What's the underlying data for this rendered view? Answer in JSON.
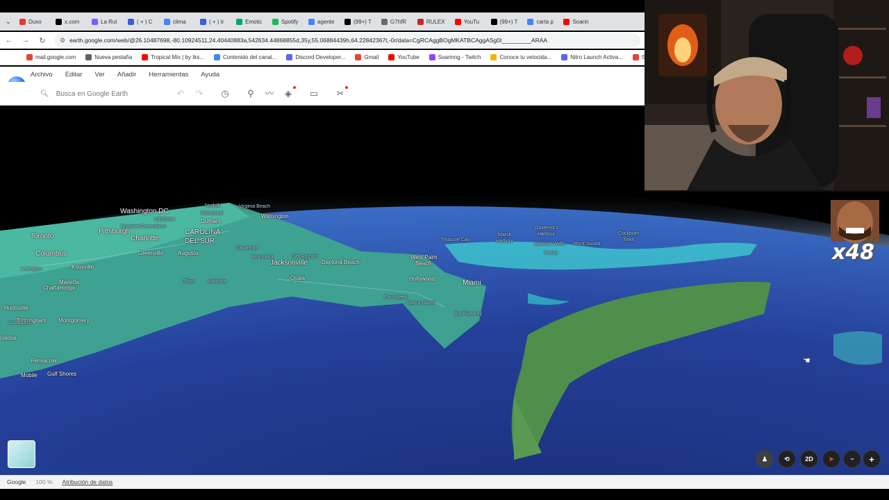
{
  "browser": {
    "tabs": [
      {
        "label": "Duxo",
        "color": "#e53935"
      },
      {
        "label": "x.com",
        "color": "#000000"
      },
      {
        "label": "La Rul",
        "color": "#7b5cff"
      },
      {
        "label": "( + ) C",
        "color": "#3b5bdb"
      },
      {
        "label": "clima",
        "color": "#4285f4"
      },
      {
        "label": "( + ) Ir",
        "color": "#3b5bdb"
      },
      {
        "label": "Emotic",
        "color": "#00a86b"
      },
      {
        "label": "Spotify",
        "color": "#1db954"
      },
      {
        "label": "agente",
        "color": "#4285f4"
      },
      {
        "label": "(99+) T",
        "color": "#000000"
      },
      {
        "label": "G7hfR",
        "color": "#6b6b6b"
      },
      {
        "label": "RULEX",
        "color": "#c62828"
      },
      {
        "label": "YouTu",
        "color": "#ff0000"
      },
      {
        "label": "(99+) T",
        "color": "#000000"
      },
      {
        "label": "carta p",
        "color": "#4285f4"
      },
      {
        "label": "Soarin",
        "color": "#ff0000"
      }
    ],
    "url": "earth.google.com/web/@26.10487698,-80.10924511,24.40440883a,542634.44868855d,35y,55.06884439h,64.22842367t,-0r/data=CgRCAggBOgMKATBCAggASg0I_________ARAA",
    "bookmarks": [
      {
        "label": "mail.google.com",
        "color": "#ea4335"
      },
      {
        "label": "Nueva pestaña",
        "color": "#5f6368"
      },
      {
        "label": "Tropical Mix | by Iks...",
        "color": "#ff0000"
      },
      {
        "label": "Contenido del canal...",
        "color": "#4285f4"
      },
      {
        "label": "Discord Developer...",
        "color": "#5865f2"
      },
      {
        "label": "Gmail",
        "color": "#ea4335"
      },
      {
        "label": "YouTube",
        "color": "#ff0000"
      },
      {
        "label": "Soarinng - Twitch",
        "color": "#9146ff"
      },
      {
        "label": "Conoce tu velocida...",
        "color": "#f4b400"
      },
      {
        "label": "Nitro Launch Activa...",
        "color": "#5865f2"
      },
      {
        "label": "Si",
        "color": "#ea4335"
      }
    ]
  },
  "earth": {
    "menu": [
      "Archivo",
      "Editar",
      "Ver",
      "Añadir",
      "Herramientas",
      "Ayuda"
    ],
    "search_placeholder": "Busca en Google Earth",
    "toolbar_icons": [
      "undo-icon",
      "redo-icon",
      "history-icon",
      "placemark-icon",
      "path-icon",
      "layers-icon",
      "measure-icon",
      "tools-icon"
    ]
  },
  "map_labels": [
    {
      "text": "Washington DC",
      "size": "big"
    },
    {
      "text": "VIRGINIA",
      "size": "dim"
    },
    {
      "text": "Norfolk",
      "size": "dim"
    },
    {
      "text": "Virginia Beach",
      "size": "dim"
    },
    {
      "text": "Richmond",
      "size": "dim"
    },
    {
      "text": "Durham",
      "size": ""
    },
    {
      "text": "Roanoke",
      "size": "dim"
    },
    {
      "text": "Greensboro",
      "size": "dim"
    },
    {
      "text": "Wilmington",
      "size": ""
    },
    {
      "text": "Toronto",
      "size": "big"
    },
    {
      "text": "Pittsburgh",
      "size": "big"
    },
    {
      "text": "Charlotte",
      "size": "big"
    },
    {
      "text": "CAROLINA",
      "size": "big"
    },
    {
      "text": "DEL SUR",
      "size": "big"
    },
    {
      "text": "Columbus",
      "size": "big"
    },
    {
      "text": "Savannah",
      "size": "dim"
    },
    {
      "text": "Greenville",
      "size": ""
    },
    {
      "text": "Augusta",
      "size": ""
    },
    {
      "text": "Lexington",
      "size": "dim"
    },
    {
      "text": "Knoxville",
      "size": ""
    },
    {
      "text": "Brunswick",
      "size": "dim"
    },
    {
      "text": "San Agustín",
      "size": "dim"
    },
    {
      "text": "Jacksonville",
      "size": "big"
    },
    {
      "text": "Daytona Beach",
      "size": ""
    },
    {
      "text": "Marietta",
      "size": ""
    },
    {
      "text": "Chattanooga",
      "size": ""
    },
    {
      "text": "Tifton",
      "size": "dim"
    },
    {
      "text": "Valdosta",
      "size": "dim"
    },
    {
      "text": "Ocala",
      "size": ""
    },
    {
      "text": "West Palm",
      "size": ""
    },
    {
      "text": "Beach",
      "size": ""
    },
    {
      "text": "Hollywood",
      "size": ""
    },
    {
      "text": "Miami",
      "size": "big"
    },
    {
      "text": "Treasure Cay",
      "size": "dim"
    },
    {
      "text": "Marsh",
      "size": "dim"
    },
    {
      "text": "Harbour",
      "size": "dim"
    },
    {
      "text": "Governor's",
      "size": "dim"
    },
    {
      "text": "Harbour",
      "size": "dim"
    },
    {
      "text": "Spanish Wells",
      "size": "dim"
    },
    {
      "text": "Rock Sound",
      "size": "dim"
    },
    {
      "text": "Nasáu",
      "size": "dim"
    },
    {
      "text": "Cockburn",
      "size": "dim"
    },
    {
      "text": "Town",
      "size": "dim"
    },
    {
      "text": "Huntsville",
      "size": ""
    },
    {
      "text": "Birmingham",
      "size": ""
    },
    {
      "text": "ALABAMA",
      "size": "dim"
    },
    {
      "text": "Montgomery",
      "size": ""
    },
    {
      "text": "Pensacola",
      "size": ""
    },
    {
      "text": "Gulf Shores",
      "size": ""
    },
    {
      "text": "Mobile",
      "size": ""
    },
    {
      "text": "calosa",
      "size": ""
    },
    {
      "text": "Fort Myers",
      "size": "dim"
    },
    {
      "text": "Marco Island",
      "size": "dim"
    },
    {
      "text": "Big Pine Key",
      "size": "dim"
    }
  ],
  "status": {
    "brand": "Google",
    "zoom": "100 %",
    "attribution": "Atribución de datos"
  },
  "controls": {
    "view_2d": "2D",
    "zoom_in": "+"
  },
  "overlay": {
    "multiplier": "x48"
  }
}
